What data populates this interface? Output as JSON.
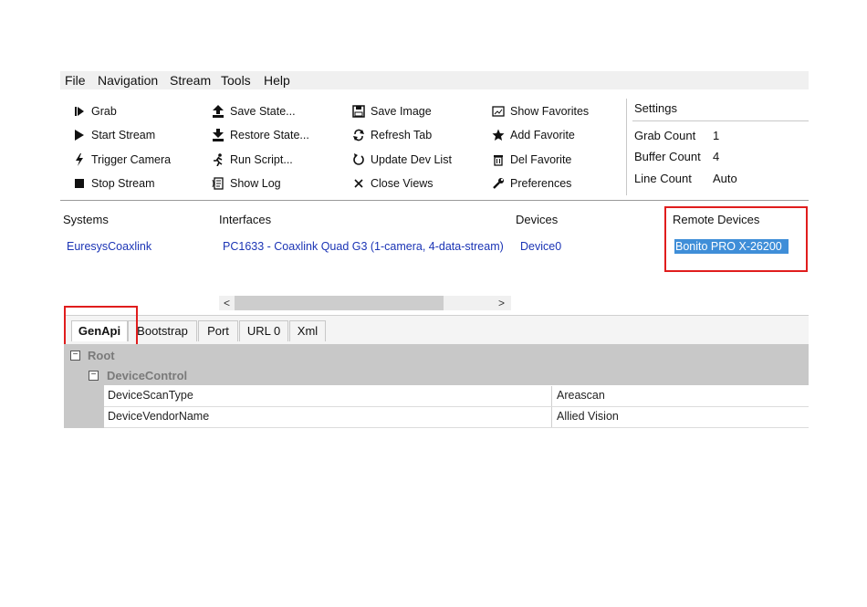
{
  "menu": [
    "File",
    "Navigation",
    "Stream",
    "Tools",
    "Help"
  ],
  "toolbar": {
    "col1": [
      {
        "label": "Grab",
        "icon": "step-icon"
      },
      {
        "label": "Start Stream",
        "icon": "play-icon"
      },
      {
        "label": "Trigger Camera",
        "icon": "lightning-icon"
      },
      {
        "label": "Stop Stream",
        "icon": "stop-icon"
      }
    ],
    "col2": [
      {
        "label": "Save State...",
        "icon": "upload-icon"
      },
      {
        "label": "Restore State...",
        "icon": "download-icon"
      },
      {
        "label": "Run Script...",
        "icon": "run-icon"
      },
      {
        "label": "Show Log",
        "icon": "log-icon"
      }
    ],
    "col3": [
      {
        "label": "Save Image",
        "icon": "floppy-icon"
      },
      {
        "label": "Refresh Tab",
        "icon": "refresh-icon"
      },
      {
        "label": "Update Dev List",
        "icon": "update-icon"
      },
      {
        "label": "Close Views",
        "icon": "close-icon"
      }
    ],
    "col4": [
      {
        "label": "Show Favorites",
        "icon": "favorites-window-icon"
      },
      {
        "label": "Add Favorite",
        "icon": "star-icon"
      },
      {
        "label": "Del Favorite",
        "icon": "trash-icon"
      },
      {
        "label": "Preferences",
        "icon": "wrench-icon"
      }
    ]
  },
  "settings": {
    "title": "Settings",
    "grab_count_label": "Grab Count",
    "grab_count": "1",
    "buffer_count_label": "Buffer Count",
    "buffer_count": "4",
    "line_count_label": "Line Count",
    "line_count": "Auto"
  },
  "browser": {
    "systems_header": "Systems",
    "interfaces_header": "Interfaces",
    "devices_header": "Devices",
    "remote_header": "Remote Devices",
    "system": "EuresysCoaxlink",
    "interface": "PC1633 - Coaxlink Quad G3 (1-camera, 4-data-stream)",
    "device": "Device0",
    "remote_device": "Bonito PRO X-26200"
  },
  "scroll": {
    "left": "<",
    "right": ">"
  },
  "tabs": [
    "GenApi",
    "Bootstrap",
    "Port",
    "URL 0",
    "Xml"
  ],
  "tree": {
    "root": "Root",
    "root_toggle": "−",
    "node": "DeviceControl",
    "node_toggle": "−",
    "rows": [
      {
        "name": "DeviceScanType",
        "value": "Areascan"
      },
      {
        "name": "DeviceVendorName",
        "value": "Allied Vision"
      }
    ]
  },
  "colors": {
    "annotation": "#e01d1d",
    "link": "#1b34b5",
    "selection": "#3f8ed8"
  }
}
